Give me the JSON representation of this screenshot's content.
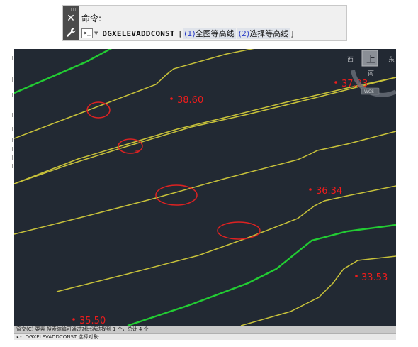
{
  "command_panel": {
    "history_text": "命令:",
    "command_name": "DGXELEVADDCONST",
    "bracket_open": "[",
    "bracket_close": "]",
    "options": [
      {
        "key": "(1)",
        "label": "全图等高线"
      },
      {
        "key": "(2)",
        "label": "选择等高线"
      }
    ]
  },
  "viewcube": {
    "top": "上",
    "west": "西",
    "east": "东",
    "south": "南",
    "wcs": "WCS"
  },
  "elevation_labels": [
    {
      "text": "38.60"
    },
    {
      "text": "37.93"
    },
    {
      "text": "36.34"
    },
    {
      "text": "33.53"
    },
    {
      "text": "35.50"
    }
  ],
  "status_text": "窗交(C) 要素  搜索缩编可通过对比活动找到 1 个，总计 4 个",
  "command_line_text": "DGXELEVADDCONST 选择对象:",
  "colors": {
    "background": "#222933",
    "contour_yellow": "#c8c23a",
    "contour_green": "#22cc33",
    "label_red": "#ee1c1c",
    "marker_red": "#dd2222"
  }
}
